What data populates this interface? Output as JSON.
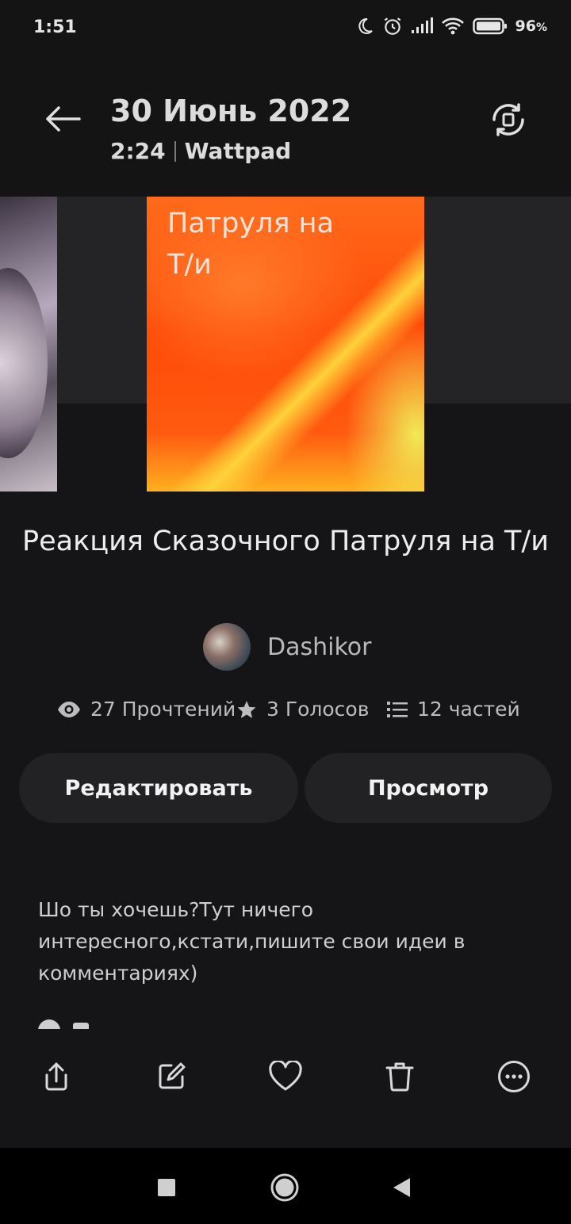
{
  "status_bar": {
    "time": "1:51",
    "battery": "96",
    "battery_unit": "%",
    "icons": [
      "moon-icon",
      "alarm-icon",
      "signal-icon",
      "wifi-icon",
      "battery-icon"
    ]
  },
  "header": {
    "date": "30 Июнь 2022",
    "time": "2:24",
    "app": "Wattpad"
  },
  "cover": {
    "text_line1": "Патруля на",
    "text_line2": "Т/и"
  },
  "story": {
    "title": "Реакция Сказочного Патруля на Т/и",
    "author": "Dashikor"
  },
  "stats": {
    "reads": "27 Прочтений",
    "votes": "3 Голосов",
    "parts": "12 частей"
  },
  "actions": {
    "edit_label": "Редактировать",
    "view_label": "Просмотр"
  },
  "description": "Шо ты хочешь?Тут ничего интересного,кстати,пишите свои идеи в комментариях)",
  "toolbar": [
    "share-icon",
    "edit-icon",
    "heart-icon",
    "trash-icon",
    "more-icon"
  ],
  "nav_bar": [
    "recents-icon",
    "home-icon",
    "back-triangle-icon"
  ]
}
